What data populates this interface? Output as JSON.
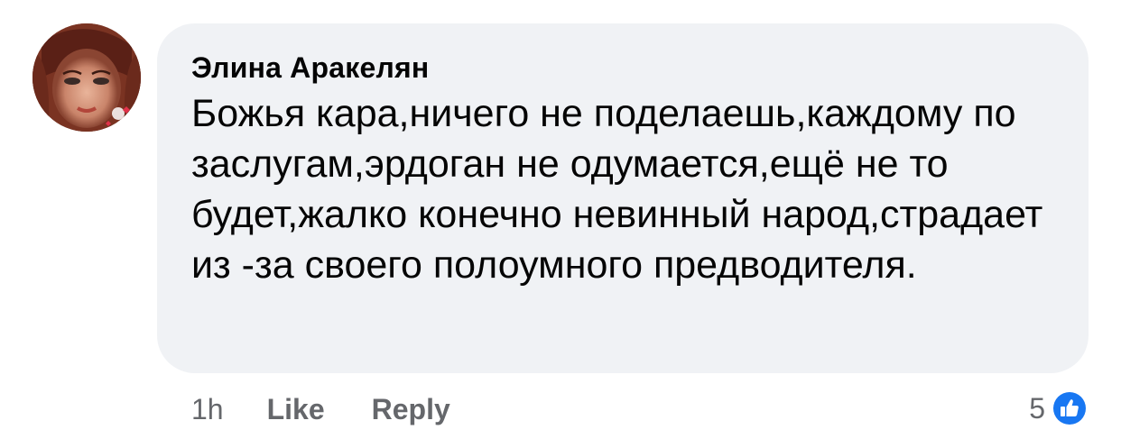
{
  "comment": {
    "author": "Элина Аракелян",
    "text": "Божья кара,ничего не поделаешь,каждому по заслугам,эрдоган не одумается,ещё не то будет,жалко конечно невинный народ,страдает из -за своего полоумного предводителя.",
    "time": "1h",
    "like_label": "Like",
    "reply_label": "Reply",
    "reaction_count": "5",
    "reaction_icon": "like-thumb-icon",
    "bubble_color": "#f0f2f5",
    "accent_color": "#1877f2",
    "meta_text_color": "#65676b"
  }
}
